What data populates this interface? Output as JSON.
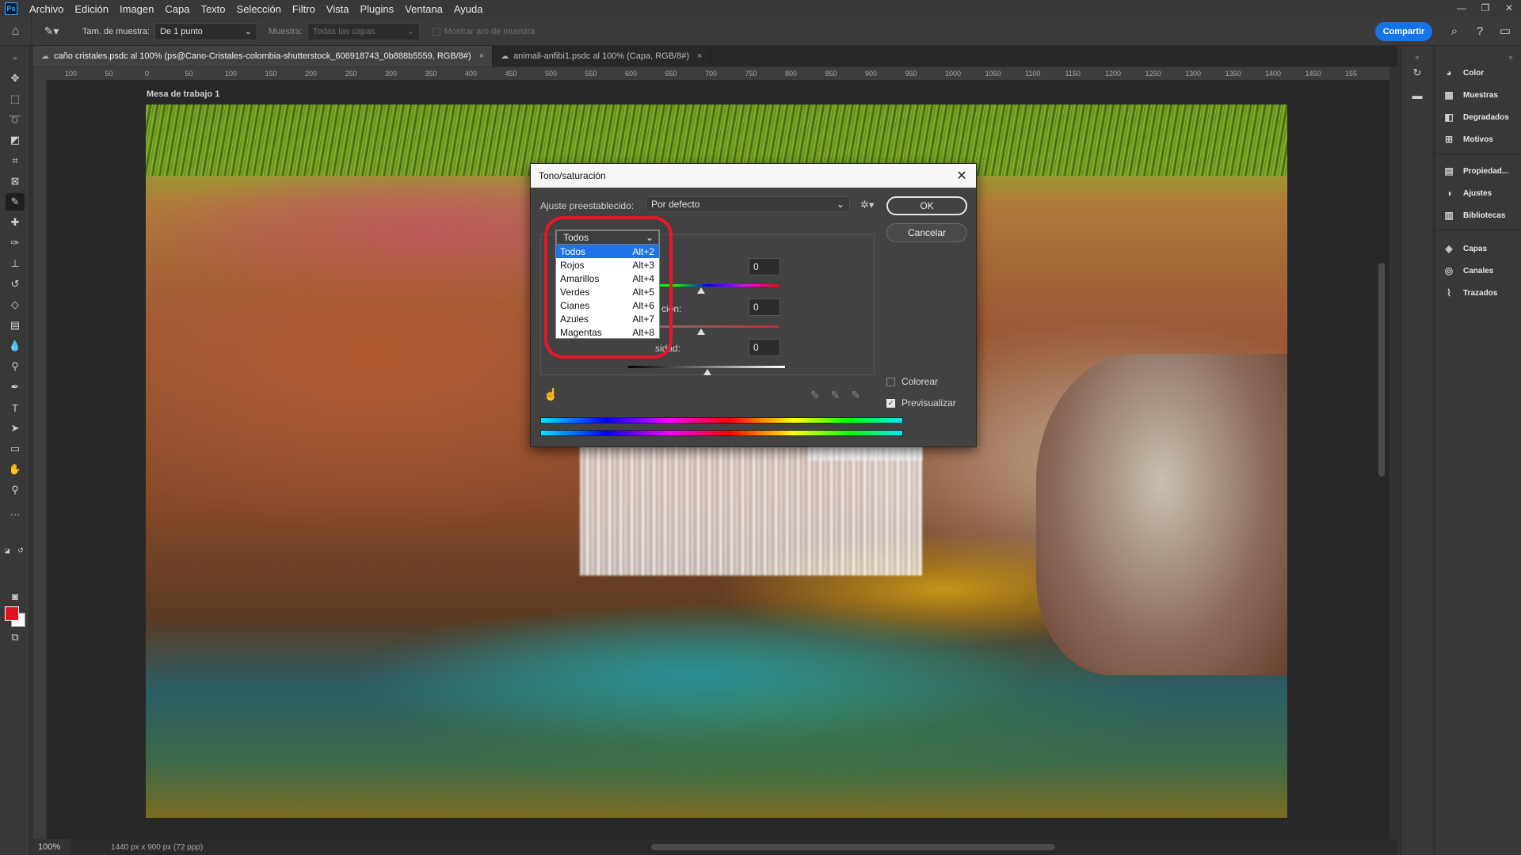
{
  "app": {
    "logo_text": "Ps"
  },
  "menu": [
    "Archivo",
    "Edición",
    "Imagen",
    "Capa",
    "Texto",
    "Selección",
    "Filtro",
    "Vista",
    "Plugins",
    "Ventana",
    "Ayuda"
  ],
  "window_controls": {
    "minimize": "—",
    "restore": "❐",
    "close": "✕"
  },
  "options_bar": {
    "sample_size_label": "Tam. de muestra:",
    "sample_size_value": "De 1 punto",
    "sample_label": "Muestra:",
    "sample_value": "Todas las capas",
    "show_ring_label": "Mostrar aro de muestra",
    "share_label": "Compartir"
  },
  "tabs": [
    {
      "title": "caño cristales.psdc al 100% (ps@Cano-Cristales-colombia-shutterstock_606918743_0b888b5559, RGB/8#)",
      "close": "×"
    },
    {
      "title": "animali-anfibi1.psdc al 100% (Capa, RGB/8#)",
      "close": "×"
    }
  ],
  "ruler_ticks": [
    "100",
    "50",
    "0",
    "50",
    "100",
    "150",
    "200",
    "250",
    "300",
    "350",
    "400",
    "450",
    "500",
    "550",
    "600",
    "650",
    "700",
    "750",
    "800",
    "850",
    "900",
    "950",
    "1000",
    "1050",
    "1100",
    "1150",
    "1200",
    "1250",
    "1300",
    "1350",
    "1400",
    "1450",
    "155"
  ],
  "canvas": {
    "artboard_label": "Mesa de trabajo 1"
  },
  "status": {
    "zoom": "100%",
    "doc_info": "1440 px x 900 px (72 ppp)"
  },
  "right_panel": {
    "items": [
      "Color",
      "Muestras",
      "Degradados",
      "Motivos",
      "Propiedad...",
      "Ajustes",
      "Bibliotecas",
      "Capas",
      "Canales",
      "Trazados"
    ]
  },
  "dialog": {
    "title": "Tono/saturación",
    "preset_label": "Ajuste preestablecido:",
    "preset_value": "Por defecto",
    "ok": "OK",
    "cancel": "Cancelar",
    "hue_value": "0",
    "saturation_label_partial": "ción:",
    "saturation_value": "0",
    "lightness_label_partial": "sidad:",
    "lightness_value": "0",
    "colorize_label": "Colorear",
    "preview_label": "Previsualizar",
    "colorize_checked": false,
    "preview_checked": true,
    "dropdown": {
      "current": "Todos",
      "options": [
        {
          "label": "Todos",
          "shortcut": "Alt+2"
        },
        {
          "label": "Rojos",
          "shortcut": "Alt+3"
        },
        {
          "label": "Amarillos",
          "shortcut": "Alt+4"
        },
        {
          "label": "Verdes",
          "shortcut": "Alt+5"
        },
        {
          "label": "Cianes",
          "shortcut": "Alt+6"
        },
        {
          "label": "Azules",
          "shortcut": "Alt+7"
        },
        {
          "label": "Magentas",
          "shortcut": "Alt+8"
        }
      ]
    }
  },
  "colors": {
    "accent": "#1473e6",
    "foreground": "#e0141e",
    "background": "#ffffff",
    "highlight_ring": "#e8182a"
  }
}
